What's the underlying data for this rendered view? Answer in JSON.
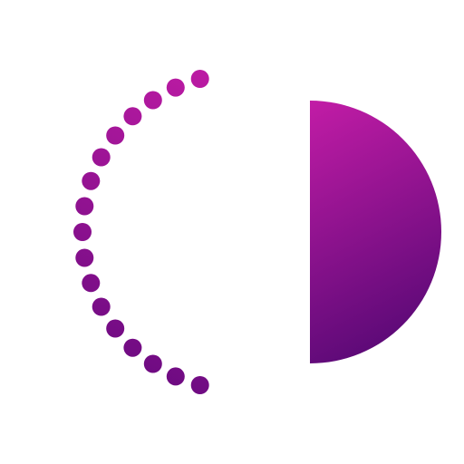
{
  "logo": {
    "name": "dotted-circle-half-moon-logo",
    "background": "#ffffff",
    "colors": {
      "magenta": "#C21CA6",
      "purple": "#6A0A80",
      "deep_purple": "#5E0A78"
    },
    "dot_count": 17
  }
}
